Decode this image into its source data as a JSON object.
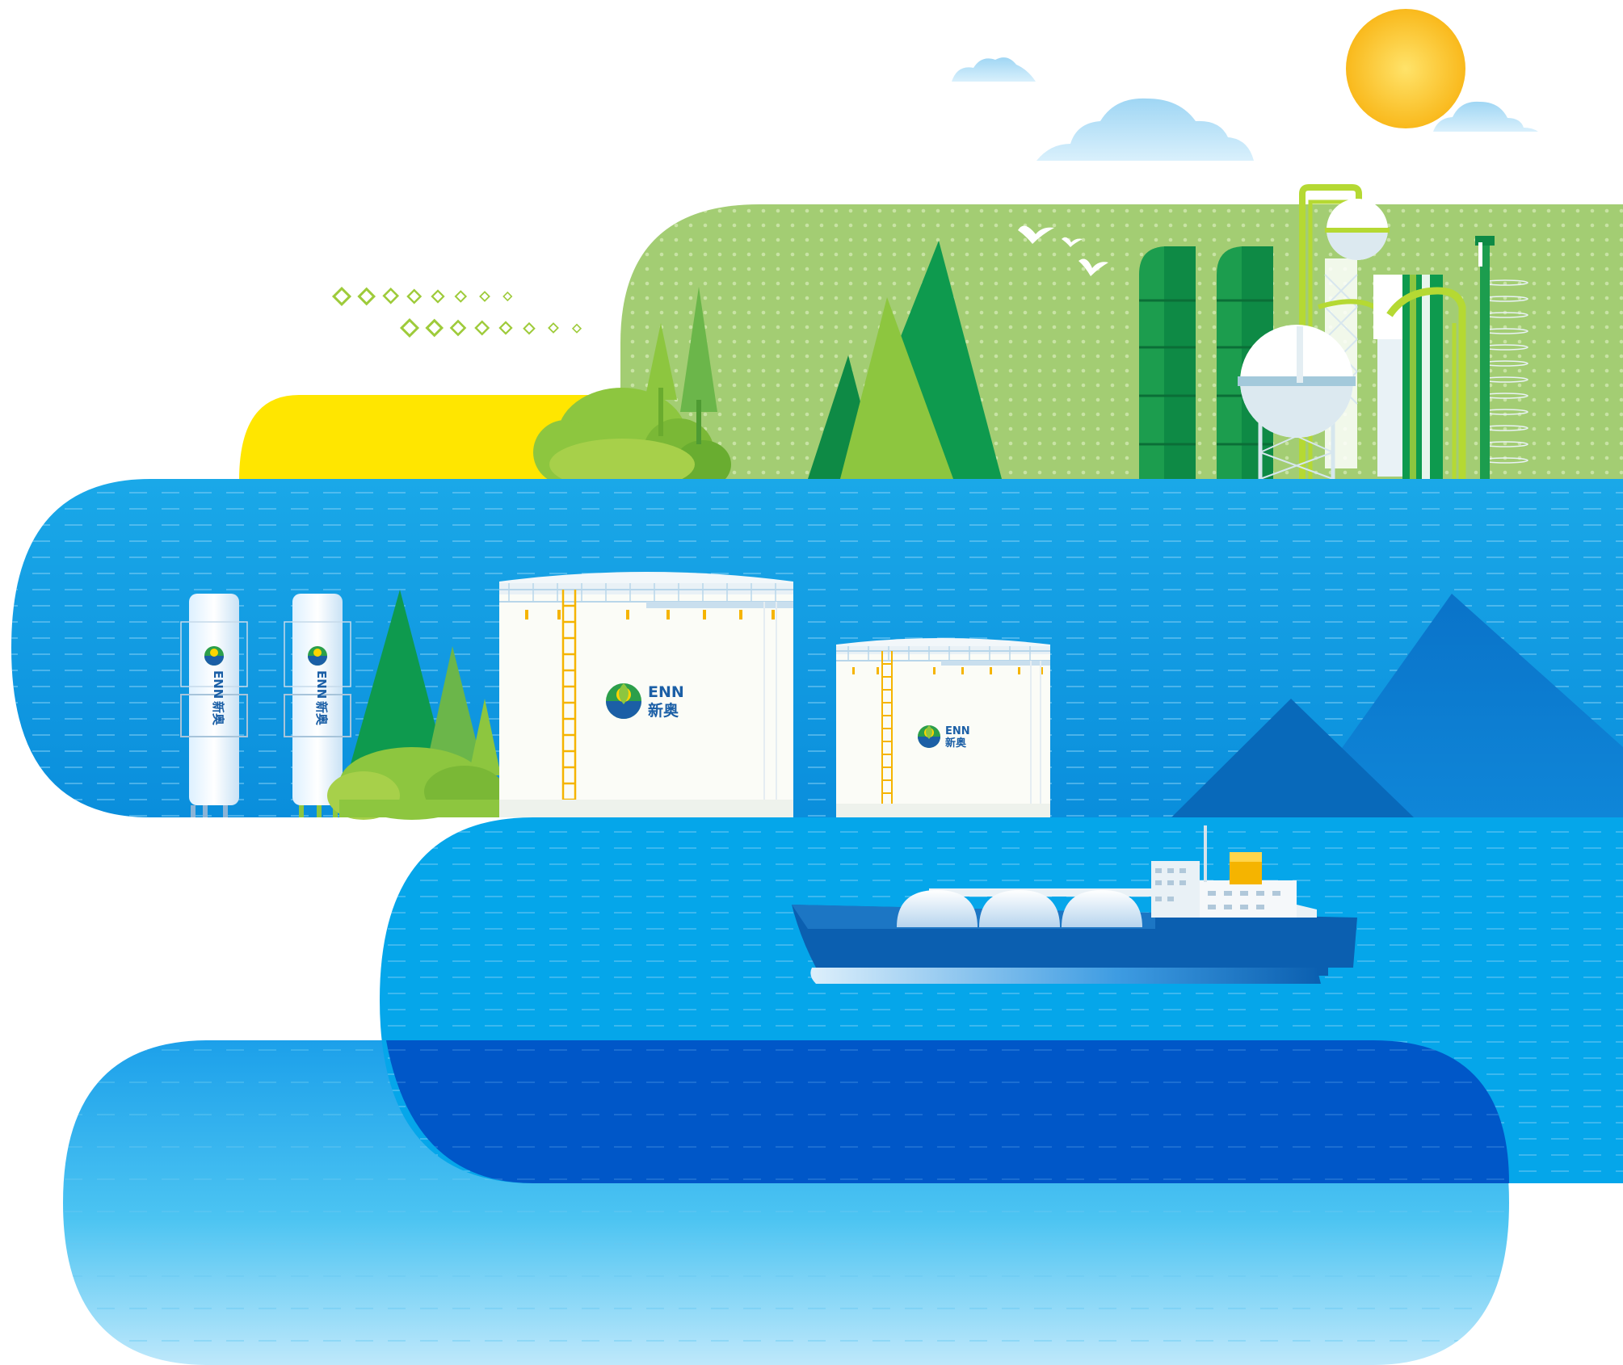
{
  "brand": {
    "logo_en": "ENN",
    "logo_cn": "新奥"
  },
  "colors": {
    "sky_sun": "#FBC531",
    "cloud": "#A9DCF5",
    "land_green": "#A3CD73",
    "hill_yellow": "#FFE600",
    "tree_dark": "#0E9A4E",
    "tree_light": "#8DC63F",
    "band_blue_1": "#1BA6E6",
    "band_blue_2": "#05A0E8",
    "band_deep": "#0057C8",
    "mountain_blue": "#0A73C9",
    "ship_hull": "#0B5FB0",
    "ship_funnel": "#F5B400",
    "ladder_yellow": "#F5B400",
    "logo_blue": "#1B5FA6"
  },
  "icons": [
    "sun-icon",
    "cloud-icon",
    "bird-icon",
    "diamond-icon",
    "tree-icon",
    "bush-icon",
    "silo-icon",
    "sphere-tank-icon",
    "storage-tank-icon",
    "mountain-icon",
    "lng-carrier-ship-icon",
    "enn-logo-icon"
  ]
}
